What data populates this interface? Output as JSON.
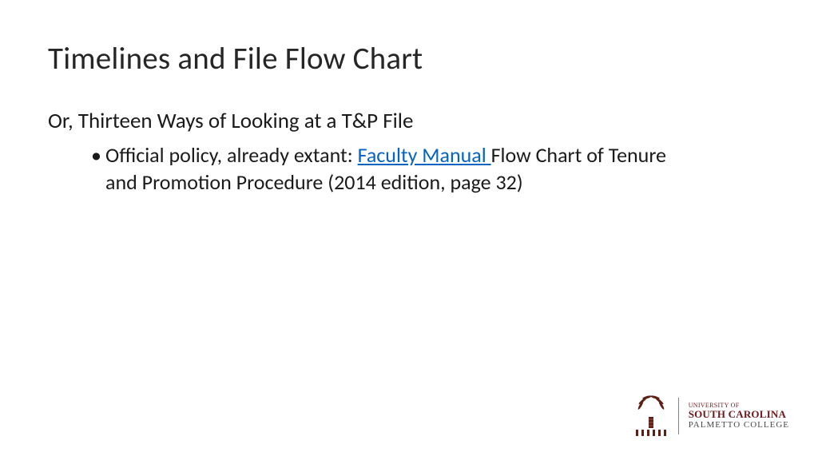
{
  "title": "Timelines and File Flow Chart",
  "subtitle": "Or, Thirteen Ways of Looking at a T&P File",
  "bullet": {
    "prefix": "Official policy, already extant: ",
    "link": "Faculty Manual ",
    "suffix": "Flow Chart of Tenure and Promotion Procedure (2014 edition, page 32)"
  },
  "logo": {
    "line1": "UNIVERSITY OF",
    "line2": "SOUTH CAROLINA",
    "line3": "PALMETTO COLLEGE"
  }
}
